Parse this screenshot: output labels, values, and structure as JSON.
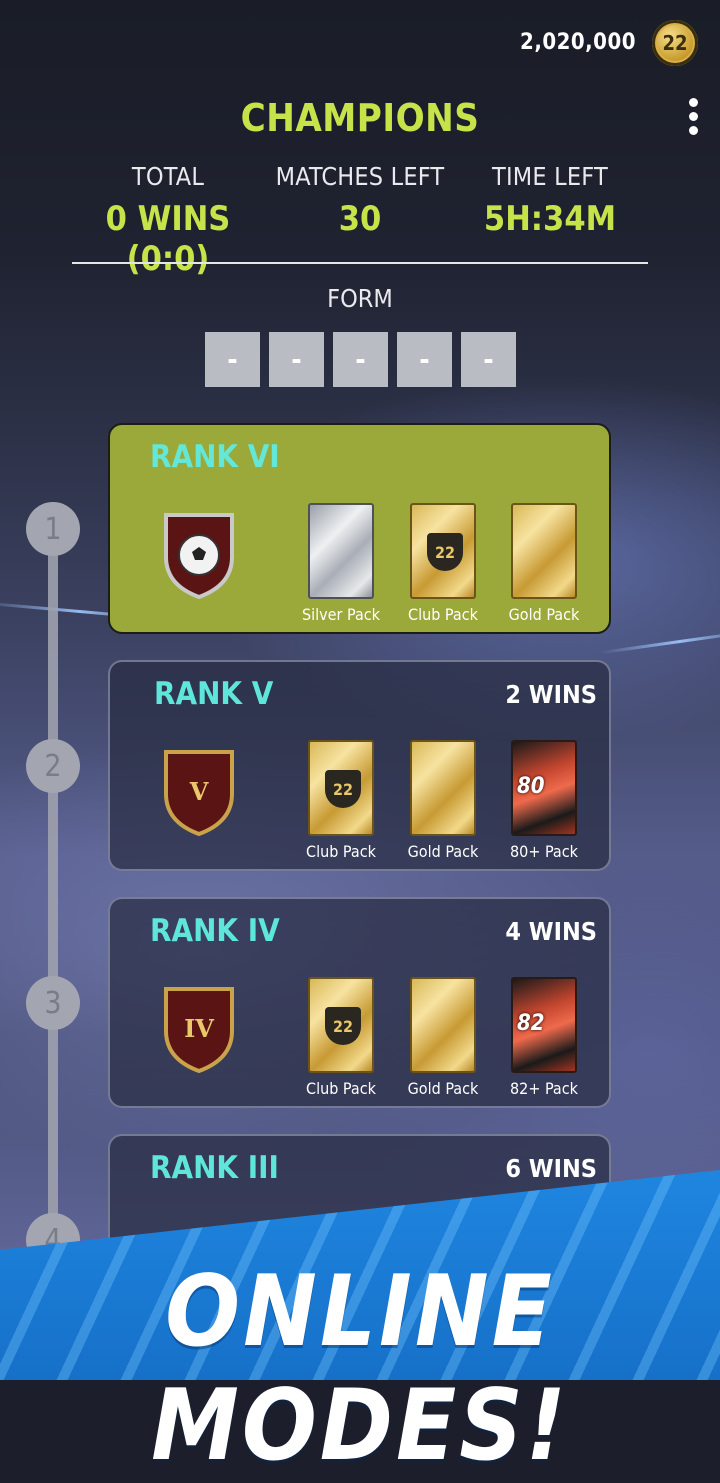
{
  "header": {
    "coins": "2,020,000",
    "coin_icon_label": "22",
    "title": "CHAMPIONS"
  },
  "stats": {
    "total": {
      "label": "TOTAL",
      "value": "0 WINS (0:0)"
    },
    "matches_left": {
      "label": "MATCHES LEFT",
      "value": "30"
    },
    "time_left": {
      "label": "TIME LEFT",
      "value": "5H:34M"
    }
  },
  "form": {
    "label": "FORM",
    "results": [
      "-",
      "-",
      "-",
      "-",
      "-"
    ]
  },
  "timeline": [
    "1",
    "2",
    "3",
    "4"
  ],
  "ranks": [
    {
      "title": "RANK VI",
      "wins": "",
      "badge": "soccer-ball",
      "packs": [
        {
          "name": "Silver Pack",
          "type": "silver",
          "label": ""
        },
        {
          "name": "Club Pack",
          "type": "gold",
          "label": "22"
        },
        {
          "name": "Gold Pack",
          "type": "gold",
          "label": ""
        }
      ]
    },
    {
      "title": "RANK V",
      "wins": "2 WINS",
      "badge": "V",
      "packs": [
        {
          "name": "Club Pack",
          "type": "gold",
          "label": "22"
        },
        {
          "name": "Gold Pack",
          "type": "gold",
          "label": ""
        },
        {
          "name": "80+ Pack",
          "type": "special",
          "label": "80"
        }
      ]
    },
    {
      "title": "RANK IV",
      "wins": "4 WINS",
      "badge": "IV",
      "packs": [
        {
          "name": "Club Pack",
          "type": "gold",
          "label": "22"
        },
        {
          "name": "Gold Pack",
          "type": "gold",
          "label": ""
        },
        {
          "name": "82+ Pack",
          "type": "special",
          "label": "82"
        }
      ]
    },
    {
      "title": "RANK III",
      "wins": "6 WINS"
    }
  ],
  "banner": {
    "text": "ONLINE MODES!"
  },
  "colors": {
    "accent": "#c7e34a",
    "rank_title": "#5fe6da",
    "active_card": "#9aa93a",
    "banner": "#1f86e0"
  }
}
